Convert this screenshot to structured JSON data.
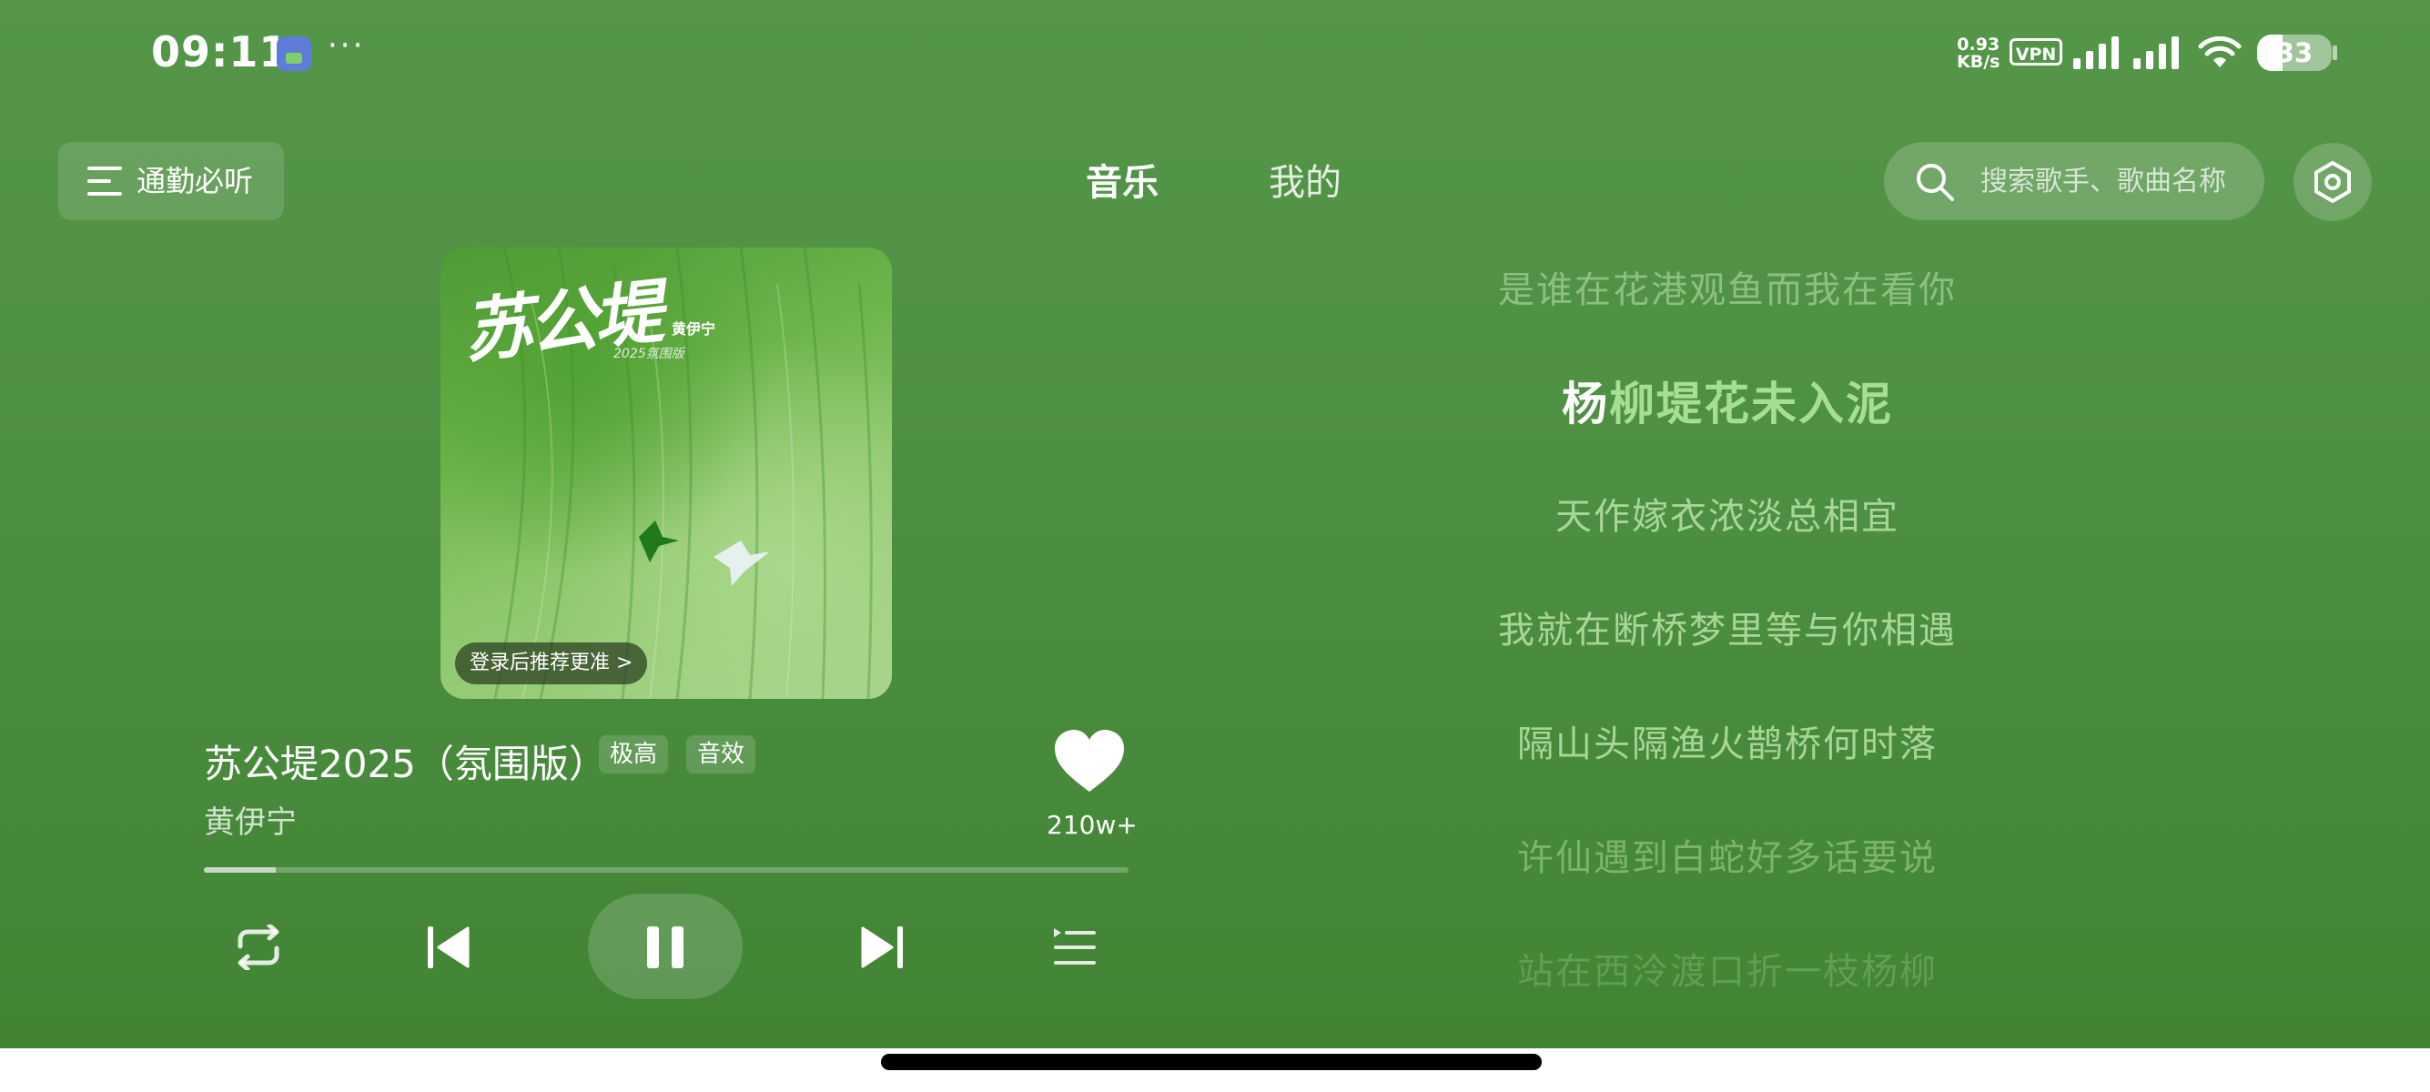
{
  "status_bar": {
    "time": "09:11",
    "dots": "···",
    "speed_value": "0.93",
    "speed_unit": "KB/s",
    "vpn": "VPN",
    "battery": "33"
  },
  "nav": {
    "menu_label": "通勤必听",
    "tabs": [
      {
        "label": "音乐",
        "active": true
      },
      {
        "label": "我的",
        "active": false
      }
    ],
    "search_placeholder": "搜索歌手、歌曲名称"
  },
  "album": {
    "title_art": "苏公堤",
    "artist_art": "黄伊宁",
    "sub_art": "2025氛围版",
    "login_prompt": "登录后推荐更准 >"
  },
  "song": {
    "title": "苏公堤2025（氛围版）",
    "badges": [
      "极高",
      "音效"
    ],
    "artist": "黄伊宁",
    "likes": "210w+",
    "progress": 0.078
  },
  "lyrics": {
    "lines": [
      "是谁在花港观鱼而我在看你",
      "杨柳堤花未入泥",
      "天作嫁衣浓淡总相宜",
      "我就在断桥梦里等与你相遇",
      "隔山头隔渔火鹊桥何时落",
      "许仙遇到白蛇好多话要说",
      "站在西泠渡口折一枝杨柳"
    ],
    "current_sung": "杨",
    "current_rest": "柳堤花未入泥"
  },
  "colors": {
    "background_top": "#559649",
    "background_bottom": "#418434",
    "lyric_highlight": "#ffffff",
    "lyric_unsung": "#a6de93"
  },
  "icons": [
    "menu-icon",
    "search-icon",
    "settings-icon",
    "heart-icon",
    "repeat-icon",
    "previous-icon",
    "pause-icon",
    "next-icon",
    "playlist-icon",
    "wifi-icon",
    "signal-icon",
    "battery-icon"
  ]
}
